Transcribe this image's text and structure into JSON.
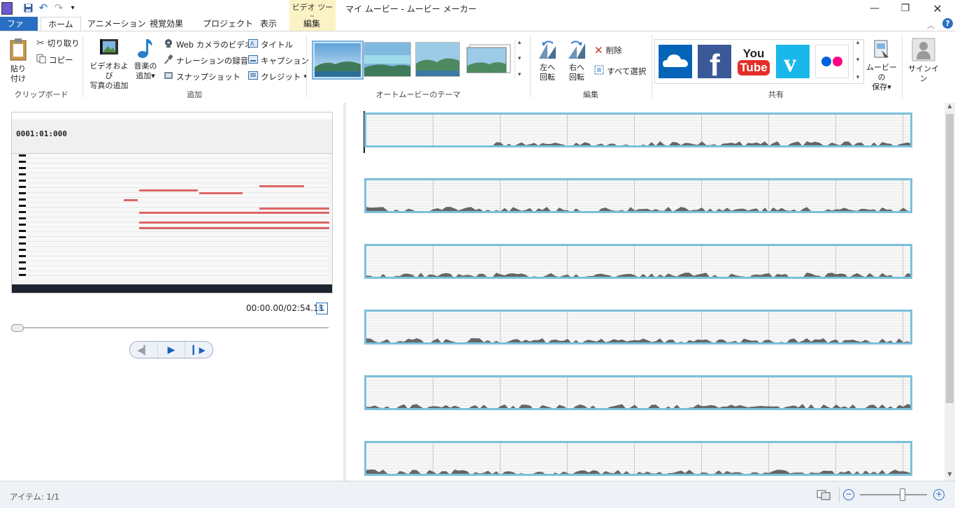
{
  "window": {
    "title": "マイ ムービー - ムービー メーカー",
    "contextual_tab_group": "ビデオ ツール",
    "controls": [
      "minimize",
      "restore",
      "close"
    ]
  },
  "tabs": [
    {
      "label": "ファイル",
      "kind": "file"
    },
    {
      "label": "ホーム",
      "active": true
    },
    {
      "label": "アニメーション"
    },
    {
      "label": "視覚効果"
    },
    {
      "label": "プロジェクト"
    },
    {
      "label": "表示"
    },
    {
      "label": "編集",
      "contextual": true
    }
  ],
  "ribbon": {
    "clipboard": {
      "label": "クリップボード",
      "paste": [
        "貼り",
        "付け"
      ],
      "cut": "切り取り",
      "copy": "コピー"
    },
    "add": {
      "label": "追加",
      "add_video_photo": [
        "ビデオおよび",
        "写真の追加"
      ],
      "add_music": [
        "音楽の",
        "追加"
      ],
      "webcam_video": "Web カメラのビデオ",
      "record_narration": "ナレーションの録音",
      "snapshot": "スナップショット",
      "title": "タイトル",
      "caption": "キャプション",
      "credits": "クレジット"
    },
    "automovie": {
      "label": "オートムービーのテーマ"
    },
    "editing": {
      "label": "編集",
      "rotate_left": [
        "左へ",
        "回転"
      ],
      "rotate_right": [
        "右へ",
        "回転"
      ],
      "delete": "削除",
      "select_all": "すべて選択"
    },
    "share": {
      "label": "共有",
      "services": [
        "onedrive",
        "facebook",
        "youtube",
        "vimeo",
        "flickr"
      ],
      "youtube_text": [
        "You",
        "Tube"
      ],
      "save_movie": [
        "ムービーの",
        "保存"
      ]
    },
    "signin": "サインイン"
  },
  "preview": {
    "time": "00:00.00/02:54.11",
    "thumbnail_time": "0001:01:000"
  },
  "status": {
    "items": "アイテム: 1/1"
  },
  "colors": {
    "file_tab": "#2a6ec3",
    "contextual_tab": "#fbf3c5",
    "clip_border": "#7cc0dc",
    "facebook": "#3b5998",
    "youtube": "#e52d27",
    "vimeo": "#1ab7ea",
    "onedrive": "#0364b8",
    "flickr_blue": "#0063dc",
    "flickr_pink": "#ff0084"
  },
  "icons": [
    "save-icon",
    "undo-icon",
    "redo-icon",
    "scissors-icon",
    "copy-icon",
    "clipboard-icon",
    "film-icon",
    "music-note-icon",
    "webcam-icon",
    "microphone-icon",
    "snapshot-icon",
    "title-icon",
    "caption-icon",
    "credits-icon",
    "rotate-left-icon",
    "rotate-right-icon",
    "delete-x-icon",
    "select-all-icon",
    "save-movie-icon",
    "user-icon",
    "help-icon",
    "expand-icon",
    "play-icon",
    "prev-frame-icon",
    "next-frame-icon",
    "zoom-out-icon",
    "zoom-in-icon",
    "storyboard-view-icon"
  ]
}
